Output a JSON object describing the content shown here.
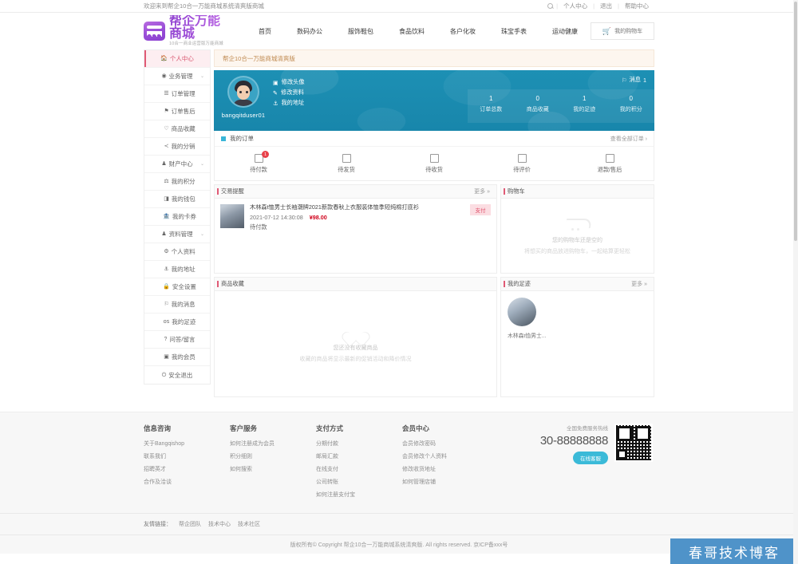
{
  "topbar": {
    "welcome": "欢迎来到帮企10合一万能商城系统清爽版商城",
    "search_icon": "search-icon",
    "links": [
      {
        "label": "个人中心"
      },
      {
        "label": "退出"
      },
      {
        "label": "帮助中心"
      }
    ]
  },
  "header": {
    "logo_title": "帮企万能商城",
    "logo_sub": "10合一商业运营版万能商城",
    "nav": [
      {
        "label": "首页"
      },
      {
        "label": "数码办公"
      },
      {
        "label": "服饰鞋包"
      },
      {
        "label": "食品饮料"
      },
      {
        "label": "各户化妆"
      },
      {
        "label": "珠宝手表"
      },
      {
        "label": "运动健康"
      }
    ],
    "cart_label": "我的购物车",
    "cart_icon": "shopping-cart-icon"
  },
  "sidebar": {
    "items": [
      {
        "label": "个人中心",
        "icon": "home-icon",
        "glyph": "⌂",
        "active": true,
        "sub": false,
        "chevron": ""
      },
      {
        "label": "业务管理",
        "icon": "briefcase-icon",
        "glyph": "◎",
        "active": false,
        "sub": false,
        "chevron": "⌄"
      },
      {
        "label": "订单管理",
        "icon": "list-icon",
        "glyph": "☰",
        "active": false,
        "sub": true,
        "chevron": ""
      },
      {
        "label": "订单售后",
        "icon": "service-icon",
        "glyph": "⚑",
        "active": false,
        "sub": true,
        "chevron": ""
      },
      {
        "label": "商品收藏",
        "icon": "heart-icon",
        "glyph": "♡",
        "active": false,
        "sub": true,
        "chevron": ""
      },
      {
        "label": "我的分销",
        "icon": "share-icon",
        "glyph": "≺",
        "active": false,
        "sub": true,
        "chevron": ""
      },
      {
        "label": "财产中心",
        "icon": "wallet-icon",
        "glyph": "♟",
        "active": false,
        "sub": false,
        "chevron": "⌄"
      },
      {
        "label": "我的积分",
        "icon": "points-icon",
        "glyph": "⚒",
        "active": false,
        "sub": true,
        "chevron": ""
      },
      {
        "label": "我的钱包",
        "icon": "money-icon",
        "glyph": "◨",
        "active": false,
        "sub": true,
        "chevron": ""
      },
      {
        "label": "我的卡券",
        "icon": "coupon-icon",
        "glyph": "⌂",
        "active": false,
        "sub": true,
        "chevron": ""
      },
      {
        "label": "资料管理",
        "icon": "user-icon",
        "glyph": "♟",
        "active": false,
        "sub": false,
        "chevron": "⌄"
      },
      {
        "label": "个人资料",
        "icon": "gear-icon",
        "glyph": "⚙",
        "active": false,
        "sub": true,
        "chevron": ""
      },
      {
        "label": "我的地址",
        "icon": "location-icon",
        "glyph": "⚓",
        "active": false,
        "sub": true,
        "chevron": ""
      },
      {
        "label": "安全设置",
        "icon": "lock-icon",
        "glyph": "⚿",
        "active": false,
        "sub": true,
        "chevron": ""
      },
      {
        "label": "我的消息",
        "icon": "bell-icon",
        "glyph": "☐",
        "active": false,
        "sub": true,
        "chevron": ""
      },
      {
        "label": "我的足迹",
        "icon": "footprint-icon",
        "glyph": "os",
        "active": false,
        "sub": true,
        "chevron": ""
      },
      {
        "label": "问答/留言",
        "icon": "question-icon",
        "glyph": "?",
        "active": false,
        "sub": true,
        "chevron": ""
      },
      {
        "label": "我的会员",
        "icon": "vip-icon",
        "glyph": "▣",
        "active": false,
        "sub": true,
        "chevron": ""
      },
      {
        "label": "安全退出",
        "icon": "power-icon",
        "glyph": "⏻",
        "active": false,
        "sub": false,
        "chevron": ""
      }
    ]
  },
  "notice": {
    "text": "帮企10合一万能商城清爽版"
  },
  "banner": {
    "username": "bangqitduser01",
    "avatar": "user-avatar",
    "links": [
      {
        "label": "修改头像",
        "icon": "image-icon",
        "glyph": "▣"
      },
      {
        "label": "修改资料",
        "icon": "edit-icon",
        "glyph": "✎"
      },
      {
        "label": "我的地址",
        "icon": "location-icon",
        "glyph": "⚓"
      }
    ],
    "message": {
      "label": "消息",
      "count": "1",
      "icon": "bell-icon",
      "glyph": "☐"
    },
    "stats": [
      {
        "num": "1",
        "label": "订单总数"
      },
      {
        "num": "0",
        "label": "商品收藏"
      },
      {
        "num": "1",
        "label": "我的足迹"
      },
      {
        "num": "0",
        "label": "我的积分"
      }
    ]
  },
  "orders": {
    "title": "我的订单",
    "view_all": "查看全部订单  ›",
    "tabs": [
      {
        "label": "待付款",
        "icon": "invoice-icon",
        "badge": "1"
      },
      {
        "label": "待发货",
        "icon": "box-icon",
        "badge": ""
      },
      {
        "label": "待收货",
        "icon": "truck-icon",
        "badge": ""
      },
      {
        "label": "待评价",
        "icon": "pencil-icon",
        "badge": ""
      },
      {
        "label": "退款/售后",
        "icon": "refund-icon",
        "badge": ""
      }
    ]
  },
  "trade_panel": {
    "title": "交易提醒",
    "more": "更多 »",
    "item": {
      "title": "木林森t恤男士长袖潮牌2021新款春秋上衣服装体恤季短纯棉打底衫",
      "date": "2021-07-12 14:30:08",
      "price": "¥98.00",
      "status": "待付款",
      "action": "支付",
      "thumb": "product-thumbnail"
    }
  },
  "cart_panel": {
    "title": "购物车",
    "icon": "empty-cart-icon",
    "empty_line1": "您的购物车还是空的",
    "empty_line2": "将想买的商品放进购物车，一起结算更轻松"
  },
  "fav_panel": {
    "title": "商品收藏",
    "icon": "heart-icon",
    "empty_line1": "您还没有收藏商品",
    "empty_line2": "收藏的商品将显示最新的促销活动和降价情况"
  },
  "footprint_panel": {
    "title": "我的足迹",
    "more": "更多 »",
    "item": {
      "name": "木林森t恤男士...",
      "thumb": "footprint-thumbnail"
    }
  },
  "footer": {
    "columns": [
      {
        "title": "信息咨询",
        "links": [
          "关于Bangqishop",
          "联系我们",
          "招聘英才",
          "合作及洽谈"
        ]
      },
      {
        "title": "客户服务",
        "links": [
          "如何注册成为会员",
          "积分细则",
          "如何搜索"
        ]
      },
      {
        "title": "支付方式",
        "links": [
          "分期付款",
          "邮局汇款",
          "在线支付",
          "公司转账",
          "如何注册支付宝"
        ]
      },
      {
        "title": "会员中心",
        "links": [
          "会员修改密码",
          "会员修改个人资料",
          "修改收货地址",
          "如何管理店铺"
        ]
      }
    ],
    "hotline_label": "全国免费服务热线",
    "hotline_number": "30-88888888",
    "service_button": "在线客服",
    "qr_icon": "qr-code-icon",
    "friend_label": "友情链接：",
    "friend_links": [
      "帮企团队",
      "技术中心",
      "技术社区"
    ],
    "copyright": "版权所有© Copyright 帮企10合一万能商城系统清爽版. All rights reserved. 京ICP备xxx号"
  },
  "watermark": {
    "text": "春哥技术博客"
  },
  "colors": {
    "brand_purple": "#9a4fd8",
    "banner_teal": "#1b8cb0",
    "accent_pink": "#e05a75",
    "price_red": "#d0021b",
    "cart_cyan": "#3bbad8",
    "notice_bg": "#fdf6ef"
  }
}
